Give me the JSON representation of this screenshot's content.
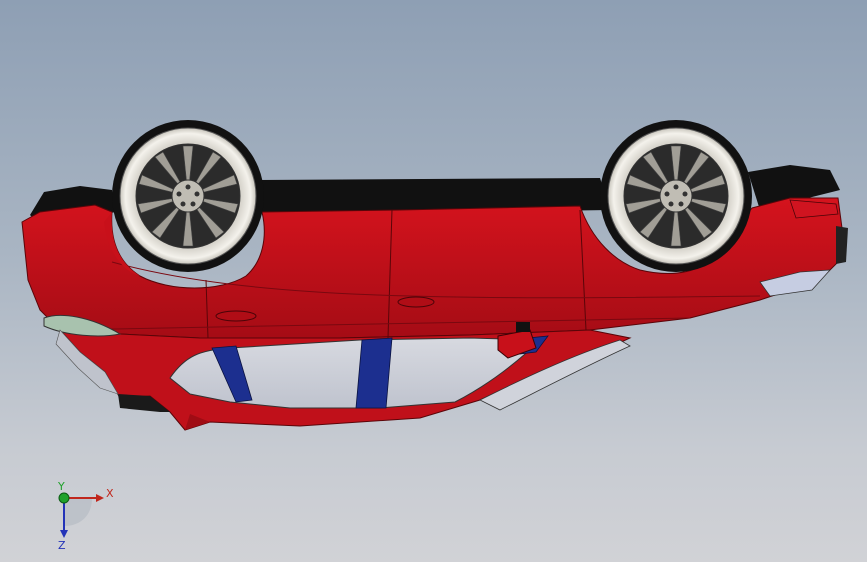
{
  "window": {
    "title": ""
  },
  "viewport": {
    "background_top": "#8e9fb4",
    "background_bottom": "#d1d2d6"
  },
  "model": {
    "body_color": "#c8101a",
    "body_shadow_color": "#8f0a12",
    "trim_color": "#111111",
    "pillar_color": "#1c2f8f",
    "glass_color": "#c9ccd6",
    "wheel_tire_color": "#ebe9e2",
    "wheel_spoke_color": "#9a9790",
    "wheel_dark_color": "#262626"
  },
  "triad": {
    "x_label": "X",
    "y_label": "Y",
    "z_label": "Z",
    "x_color": "#c0261c",
    "y_color": "#1fa12b",
    "z_color": "#2333b8",
    "x_icon": "axis-arrow-x",
    "y_icon": "axis-origin-y",
    "z_icon": "axis-arrow-z"
  }
}
